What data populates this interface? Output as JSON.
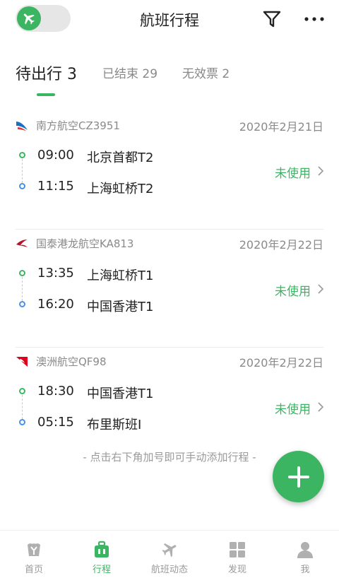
{
  "header": {
    "title": "航班行程",
    "toggle_icon": "plane-icon",
    "filter_icon": "filter-icon",
    "more_icon": "more-icon"
  },
  "tabs": [
    {
      "label": "待出行 3",
      "active": true
    },
    {
      "label": "已结束 29",
      "active": false
    },
    {
      "label": "无效票 2",
      "active": false
    }
  ],
  "trips": [
    {
      "airline": "南方航空CZ3951",
      "date": "2020年2月21日",
      "dep_time": "09:00",
      "dep_place": "北京首都T2",
      "arr_time": "11:15",
      "arr_place": "上海虹桥T2",
      "status": "未使用",
      "logo_color": "#1a6fc4"
    },
    {
      "airline": "国泰港龙航空KA813",
      "date": "2020年2月22日",
      "dep_time": "13:35",
      "dep_place": "上海虹桥T1",
      "arr_time": "16:20",
      "arr_place": "中国香港T1",
      "status": "未使用",
      "logo_color": "#b3132b"
    },
    {
      "airline": "澳洲航空QF98",
      "date": "2020年2月22日",
      "dep_time": "18:30",
      "dep_place": "中国香港T1",
      "arr_time": "05:15",
      "arr_place": "布里斯班I",
      "status": "未使用",
      "logo_color": "#e0001b"
    }
  ],
  "hint": "- 点击右下角加号即可手动添加行程 -",
  "fab_icon": "plus-icon",
  "bottom_nav": [
    {
      "label": "首页",
      "icon": "home-icon",
      "active": false
    },
    {
      "label": "行程",
      "icon": "suitcase-icon",
      "active": true
    },
    {
      "label": "航班动态",
      "icon": "plane-icon",
      "active": false
    },
    {
      "label": "发现",
      "icon": "grid-icon",
      "active": false
    },
    {
      "label": "我",
      "icon": "user-icon",
      "active": false
    }
  ],
  "colors": {
    "accent": "#3cb563",
    "arrival_dot": "#4a90e2",
    "muted_text": "#8a8a8a"
  }
}
